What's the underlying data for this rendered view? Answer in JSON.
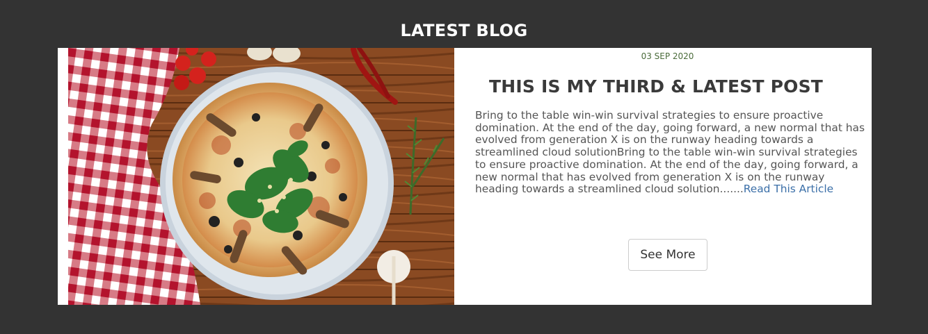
{
  "section": {
    "title": "LATEST BLOG"
  },
  "post": {
    "date": "03 SEP 2020",
    "title": "THIS IS MY THIRD & LATEST POST",
    "excerpt": "Bring to the table win-win survival strategies to ensure proactive domination. At the end of the day, going forward, a new normal that has evolved from generation X is on the runway heading towards a streamlined cloud solutionBring to the table win-win survival strategies to ensure proactive domination. At the end of the day, going forward, a new normal that has evolved from generation X is on the runway heading towards a streamlined cloud solution.......",
    "read_more_label": "Read This Article",
    "image_alt": "pizza-photo"
  },
  "actions": {
    "see_more_label": "See More"
  },
  "colors": {
    "page_background": "#333333",
    "card_background": "#ffffff",
    "link": "#3b6fa8",
    "date": "#4a6b3a"
  }
}
